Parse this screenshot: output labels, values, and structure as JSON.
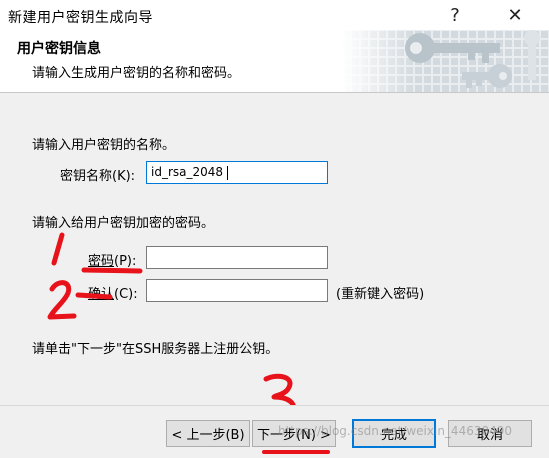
{
  "window": {
    "title": "新建用户密钥生成向导",
    "help_glyph": "?",
    "close_glyph": "✕"
  },
  "header": {
    "title": "用户密钥信息",
    "subtitle": "请输入生成用户密钥的名称和密码。"
  },
  "form": {
    "name_prompt": "请输入用户密钥的名称。",
    "name_label": "密钥名称",
    "name_label_key": "(K):",
    "name_value": "id_rsa_2048",
    "password_prompt": "请输入给用户密钥加密的密码。",
    "password_label": "密码",
    "password_key": "(P):",
    "password_value": "",
    "confirm_label": "确认",
    "confirm_key": "(C):",
    "confirm_value": "",
    "confirm_hint": "(重新键入密码)",
    "register_note": "请单击\"下一步\"在SSH服务器上注册公钥。"
  },
  "buttons": {
    "back": "< 上一步(B)",
    "next": "下一步(N) >",
    "finish": "完成",
    "cancel": "取消"
  },
  "watermark": "https://blog.csdn.net/weixin_44630490",
  "colors": {
    "accent": "#0078d7",
    "annotation": "#e8121b",
    "content_bg": "#f0f0f0"
  }
}
